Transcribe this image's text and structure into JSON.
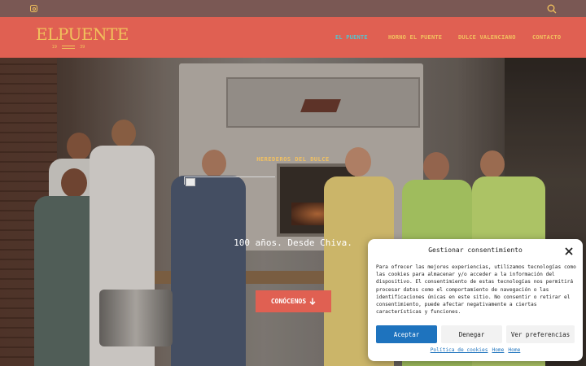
{
  "topbar": {
    "social_icon": "instagram-icon",
    "search_icon": "search-icon",
    "colors": {
      "background": "#7a5854",
      "icon": "#f1c15c"
    }
  },
  "header": {
    "logo_text": "ELPUENTE",
    "logo_left": "19",
    "logo_right": "39",
    "nav": [
      {
        "label": "EL PUENTE",
        "active": true
      },
      {
        "label": "HORNO EL PUENTE",
        "active": false
      },
      {
        "label": "DULCE VALENCIANO",
        "active": false
      },
      {
        "label": "CONTACTO",
        "active": false
      }
    ],
    "colors": {
      "background": "#e06052",
      "link": "#f3c15f",
      "active_link": "#55c4cf"
    }
  },
  "hero": {
    "kicker": "HEREDEROS DEL DULCE",
    "title": "100 años. Desde Chiva.",
    "button_label": "CONÓCENOS",
    "button_icon": "arrow-down-icon",
    "image_alt": ""
  },
  "cookie_banner": {
    "title": "Gestionar consentimiento",
    "close_icon": "close-icon",
    "text": "Para ofrecer las mejores experiencias, utilizamos tecnologías como las cookies para almacenar y/o acceder a la información del dispositivo. El consentimiento de estas tecnologías nos permitirá procesar datos como el comportamiento de navegación o las identificaciones únicas en este sitio. No consentir o retirar el consentimiento, puede afectar negativamente a ciertas características y funciones.",
    "buttons": {
      "accept": "Aceptar",
      "deny": "Denegar",
      "preferences": "Ver preferencias"
    },
    "links": [
      "Política de cookies",
      "Home",
      "Home"
    ],
    "colors": {
      "accept": "#1e73be",
      "link": "#1e73be"
    }
  }
}
